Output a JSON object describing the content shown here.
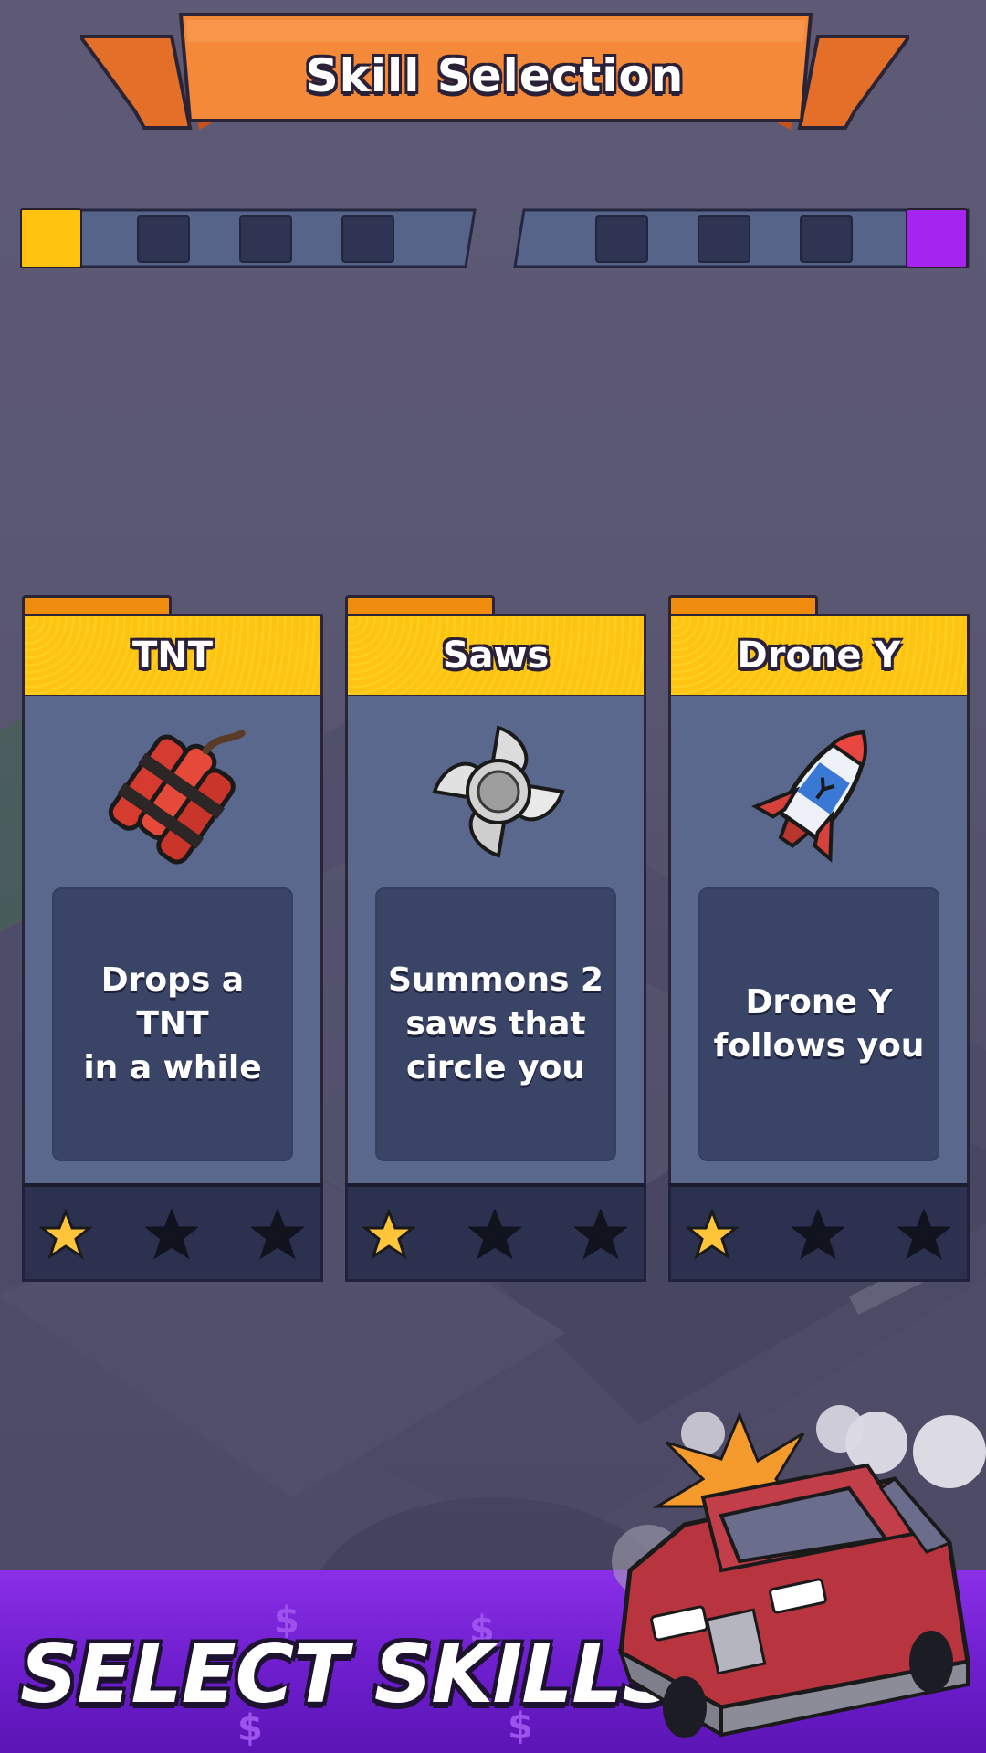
{
  "header": {
    "title": "Skill Selection"
  },
  "progress": {
    "left_slots": 3,
    "right_slots": 3,
    "start_color": "#ffc20e",
    "end_color": "#a524f0"
  },
  "cards": [
    {
      "name": "TNT",
      "description": "Drops a TNT\nin a while",
      "icon": "dynamite-icon",
      "stars_filled": 1,
      "stars_total": 3
    },
    {
      "name": "Saws",
      "description": "Summons 2\nsaws that\ncircle you",
      "icon": "saw-blade-icon",
      "stars_filled": 1,
      "stars_total": 3
    },
    {
      "name": "Drone Y",
      "description": "Drone Y\nfollows you",
      "icon": "rocket-icon",
      "stars_filled": 1,
      "stars_total": 3
    }
  ],
  "footer": {
    "title": "SELECT SKILLS!"
  },
  "colors": {
    "banner": "#f4893a",
    "card_header": "#ffc412",
    "card_body": "#5b688e",
    "footer": "#7a25d8"
  }
}
